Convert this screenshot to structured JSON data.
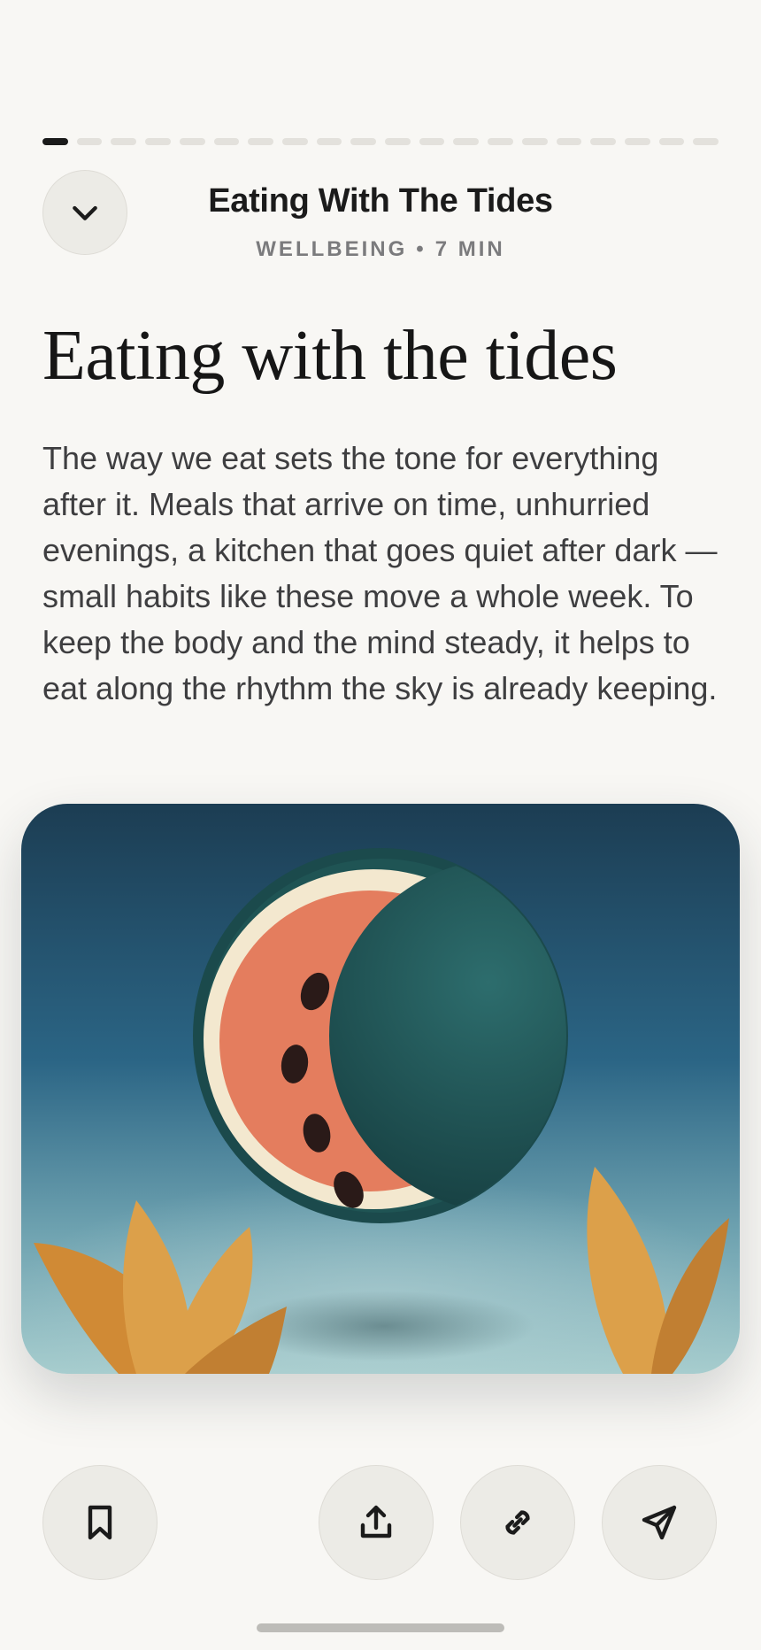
{
  "progress": {
    "total_segments": 20,
    "current_segment": 1
  },
  "header": {
    "collapse_icon": "chevron-down-icon",
    "title": "Eating With The Tides",
    "category": "WELLBEING",
    "separator": "•",
    "duration": "7 MIN"
  },
  "article": {
    "title": "Eating with the tides",
    "body": "The way we eat sets the tone for everything after it. Meals that arrive on time, unhurried evenings, a kitchen that goes quiet after dark — small habits like these move a whole week. To keep the body and the mind steady, it helps to eat along the rhythm the sky is already keeping."
  },
  "hero_image": {
    "subject": "watermelon-moon-illustration",
    "colors": {
      "sky_top": "#1c3f55",
      "sky_bottom": "#9bc4c6",
      "rind": "#1f5a58",
      "flesh": "#e47d5e",
      "pith": "#f3e8cf",
      "leaf": "#d8943c"
    }
  },
  "actions": {
    "bookmark_icon": "bookmark-icon",
    "share_icon": "share-icon",
    "link_icon": "link-icon",
    "send_icon": "send-icon"
  },
  "theme": {
    "background": "#f8f7f4",
    "button_bg": "#ecebe6",
    "accent": "#1a1a1a",
    "muted": "#7b7b7d"
  }
}
